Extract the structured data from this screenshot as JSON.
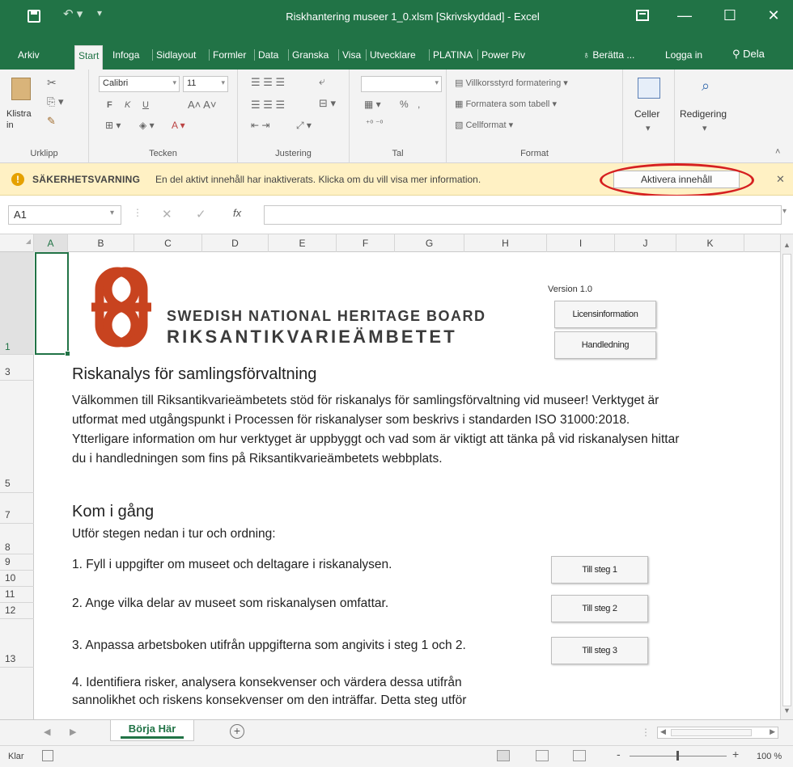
{
  "window": {
    "title": "Riskhantering museer 1_0.xlsm  [Skrivskyddad] - Excel",
    "minimize": "—",
    "maximize": "☐",
    "close": "✕"
  },
  "tabs": [
    {
      "label": "Arkiv"
    },
    {
      "label": "Start"
    },
    {
      "label": "Infoga"
    },
    {
      "label": "Sidlayout"
    },
    {
      "label": "Formler"
    },
    {
      "label": "Data"
    },
    {
      "label": "Granska"
    },
    {
      "label": "Visa"
    },
    {
      "label": "Utvecklare"
    },
    {
      "label": "PLATINA"
    },
    {
      "label": "Power Piv"
    }
  ],
  "tell_me": "Berätta ...",
  "login": "Logga in",
  "share": "Dela",
  "ribbon": {
    "clipboard": {
      "paste_label": "Klistra in",
      "group": "Urklipp"
    },
    "font": {
      "name": "Calibri",
      "size": "11",
      "bold": "F",
      "italic": "K",
      "underline": "U",
      "group": "Tecken"
    },
    "alignment": {
      "group": "Justering"
    },
    "number": {
      "format": "",
      "percent": "%",
      "group": "Tal"
    },
    "styles": {
      "conditional": "Villkorsstyrd formatering",
      "table": "Formatera som tabell",
      "cell": "Cellformat",
      "group": "Format"
    },
    "cells": {
      "label": "Celler"
    },
    "editing": {
      "label": "Redigering"
    }
  },
  "security": {
    "title": "SÄKERHETSVARNING",
    "message": "En del aktivt innehåll har inaktiverats. Klicka om du vill visa mer information.",
    "button": "Aktivera innehåll",
    "close": "✕",
    "ring_color": "#d62020"
  },
  "formula_bar": {
    "name_box": "A1",
    "cancel": "✕",
    "enter": "✓",
    "fx": "fx",
    "value": ""
  },
  "columns": [
    "A",
    "B",
    "C",
    "D",
    "E",
    "F",
    "G",
    "H",
    "I",
    "J",
    "K"
  ],
  "rows": [
    "1",
    "3",
    "5",
    "7",
    "8",
    "9",
    "10",
    "11",
    "12",
    "13"
  ],
  "sheet": {
    "logo_line1": "SWEDISH NATIONAL HERITAGE BOARD",
    "logo_line2": "RIKSANTIKVARIEÄMBETET",
    "logo_color": "#c8431f",
    "version": "Version 1.0",
    "license_button": "Licensinformation",
    "guide_button": "Handledning",
    "heading": "Riskanalys för samlingsförvaltning",
    "intro": "Välkommen till Riksantikvarieämbetets stöd för riskanalys för samlingsförvaltning vid museer! Verktyget är utformat med utgångspunkt i Processen för riskanalyser som beskrivs i standarden ISO 31000:2018. Ytterligare information om hur verktyget är uppbyggt och vad som är viktigt att tänka på vid riskanalysen hittar du i handledningen som fins på Riksantikvarieämbetets webbplats.",
    "subheading": "Kom i gång",
    "instruction": "Utför stegen nedan i tur och ordning:",
    "steps": [
      {
        "text": "1. Fyll i uppgifter om museet och deltagare i riskanalysen.",
        "button": "Till steg 1"
      },
      {
        "text": "2. Ange vilka delar av museet som riskanalysen omfattar.",
        "button": "Till steg 2"
      },
      {
        "text": "3. Anpassa arbetsboken utifrån uppgifterna som angivits i steg 1 och 2.",
        "button": "Till steg 3"
      }
    ],
    "step4_line1": "4. Identifiera risker, analysera konsekvenser och värdera dessa utifrån",
    "step4_line2": "sannolikhet och riskens konsekvenser om den inträffar. Detta steg utför"
  },
  "sheet_tab": "Börja Här",
  "add_sheet": "+",
  "status": {
    "ready": "Klar",
    "zoom_minus": "-",
    "zoom_plus": "+",
    "zoom": "100 %",
    "zoom_level": 1.0
  },
  "accent": "#217346"
}
